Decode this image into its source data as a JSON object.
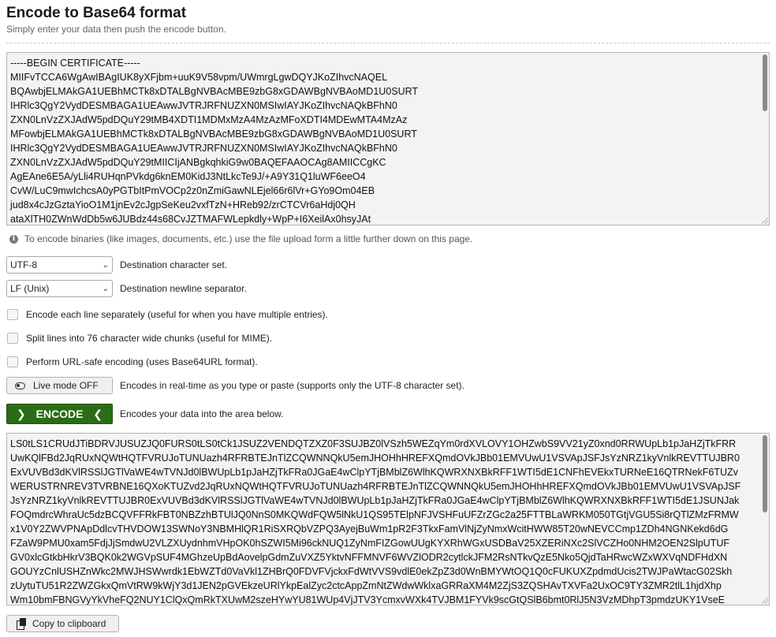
{
  "header": {
    "title": "Encode to Base64 format",
    "subtitle": "Simply enter your data then push the encode button."
  },
  "input": {
    "lines": [
      "-----BEGIN CERTIFICATE-----",
      "MIIFvTCCA6WgAwIBAgIUK8yXFjbm+uuK9V58vpm/UWmrgLgwDQYJKoZIhvcNAQEL",
      "BQAwbjELMAkGA1UEBhMCTk8xDTALBgNVBAcMBE9zbG8xGDAWBgNVBAoMD1U0SURT",
      "IHRlc3QgY2VydDESMBAGA1UEAwwJVTRJRFNUZXN0MSIwIAYJKoZIhvcNAQkBFhN0",
      "ZXN0LnVzZXJAdW5pdDQuY29tMB4XDTI1MDMxMzA4MzAzMFoXDTI4MDEwMTA4MzAz",
      "MFowbjELMAkGA1UEBhMCTk8xDTALBgNVBAcMBE9zbG8xGDAWBgNVBAoMD1U0SURT",
      "IHRlc3QgY2VydDESMBAGA1UEAwwJVTRJRFNUZXN0MSIwIAYJKoZIhvcNAQkBFhN0",
      "ZXN0LnVzZXJAdW5pdDQuY29tMIICIjANBgkqhkiG9w0BAQEFAAOCAg8AMIICCgKC",
      "AgEAne6E5A/yLli4RUHqnPVkdg6knEM0KidJ3NtLkcTe9J/+A9Y31Q1luWF6eeO4",
      "CvW/LuC9mwIchcsA0yPGTbItPmVOCp2z0nZmiGawNLEjel66r6lVr+GYo9Om04EB",
      "jud8x4cJzGztaYioO1M1jnEv2cJgpSeKeu2vxfTzN+HReb92/zrCTCVr6aHdj0QH",
      "ataXlTH0ZWnWdDb5w6JUBdz44s68CvJZTMAFWLepkdly+WpP+I6XeilAx0hsyJAt"
    ],
    "scroll_thumb_ratio": 0.33
  },
  "info_text": "To encode binaries (like images, documents, etc.) use the file upload form a little further down on this page.",
  "options": {
    "charset": {
      "value": "UTF-8",
      "label": "Destination character set."
    },
    "newline": {
      "value": "LF (Unix)",
      "label": "Destination newline separator."
    },
    "each_line": {
      "label": "Encode each line separately (useful for when you have multiple entries).",
      "checked": false
    },
    "split_lines": {
      "label": "Split lines into 76 character wide chunks (useful for MIME).",
      "checked": false
    },
    "url_safe": {
      "label": "Perform URL-safe encoding (uses Base64URL format).",
      "checked": false
    },
    "live_mode": {
      "button_label": "Live mode OFF",
      "label": "Encodes in real-time as you type or paste (supports only the UTF-8 character set)."
    }
  },
  "encode": {
    "button_label": "ENCODE",
    "label": "Encodes your data into the area below."
  },
  "output": {
    "lines": [
      "LS0tLS1CRUdJTiBDRVJUSUZJQ0FURS0tLS0tCk1JSUZ2VENDQTZXZ0F3SUJBZ0lVSzh5WEZqYm0rdXVLOVY1OHZwbS9VV21yZ0xnd0RRWUpLb1pJaHZjTkFRR",
      "UwKQlFBd2JqRUxNQWtHQTFVRUJoTUNUazh4RFRBTEJnTlZCQWNNQkU5emJHOHhHREFXQmdOVkJBb01EMVUwU1VSVApJSFJsYzNRZ1kyVnlkREVTTUJBR0",
      "ExVUVBd3dKVlRSSlJGTlVaWE4wTVNJd0lBWUpLb1pJaHZjTkFRa0JGaE4wClpYTjBMblZ6WlhKQWRXNXBkRFF1WTI5dE1CNFhEVEkxTURNeE16QTRNekF6TUZv",
      "WERUSTRNREV3TVRBNE16QXoKTUZvd2JqRUxNQWtHQTFVRUJoTUNUazh4RFRBTEJnTlZCQWNNQkU5emJHOHhHREFXQmdOVkJBb01EMVUwU1VSVApJSF",
      "JsYzNRZ1kyVnlkREVTTUJBR0ExVUVBd3dKVlRSSlJGTlVaWE4wTVNJd0lBWUpLb1pJaHZjTkFRa0JGaE4wClpYTjBMblZ6WlhKQWRXNXBkRFF1WTI5dE1JSUNJak",
      "FOQmdrcWhraUc5dzBCQVFFRkFBT0NBZzhBTUlJQ0NnS0MKQWdFQW5lNkU1QS95TElpNFJVSHFuUFZrZGc2a25FTTBLaWRKM050TGtjVGU5Si8rQTlZMzFRMW",
      "x1V0Y2ZWVPNApDdlcvTHVDOW13SWNoY3NBMHlQR1RiSXRQbVZPQ3AyejBuWm1pR2F3TkxFamVlNjZyNmxWcitHWW85T20wNEVCCmp1ZDh4NGNKekd6dG",
      "FZaW9PMU0xam5FdjJjSmdwU2VLZXUydnhmVHpOK0hSZWI5Mi96ckNUQ1ZyNmFIZGowUUgKYXRhWGxUSDBaV25XZERiNXc2SlVCZHo0NHM2OEN2SlpUTUF",
      "GV0xlcGtkbHkrV3BQK0k2WGVpSUF4MGhzeUpBdAovelpGdmZuVXZ5YktvNFFMNVF6WVZlODR2cytlckJFM2RsNTkvQzE5Nko5QjdTaHRwcWZxWXVqNDFHdXN",
      "GOUYzCnlUSHZnWkc2MWJHSWwrdk1EbWZTd0VaVkl1ZHBrQ0FDVFVjckxFdWtVVS9vdlE0ekZpZ3d0WnBMYWtOQ1Q0cFUKUXZpdmdUcis2TWJPaWtacG02Skh",
      "zUytuTU51R2ZWZGkxQmVtRW9kWjY3d1JEN2pGVEkzeURlYkpEalZyc2ctcAppZmNtZWdwWklxaGRRaXM4M2ZjS3ZQSHAvTXVFa2UxOC9TY3ZMR2tlL1hjdXhp",
      "Wm10bmFBNGVyYkVheFQ2NUY1ClQxQmRkTXUwM2szeHYwYU81WUp4VjJTV3YcmxvWXk4TVJBM1FYVk9scGtQSlB6bmt0RlJ5N3VzMDhpT3pmdzUKY1VseE"
    ],
    "scroll_thumb_ratio": 0.45
  },
  "copy": {
    "button_label": "Copy to clipboard"
  }
}
